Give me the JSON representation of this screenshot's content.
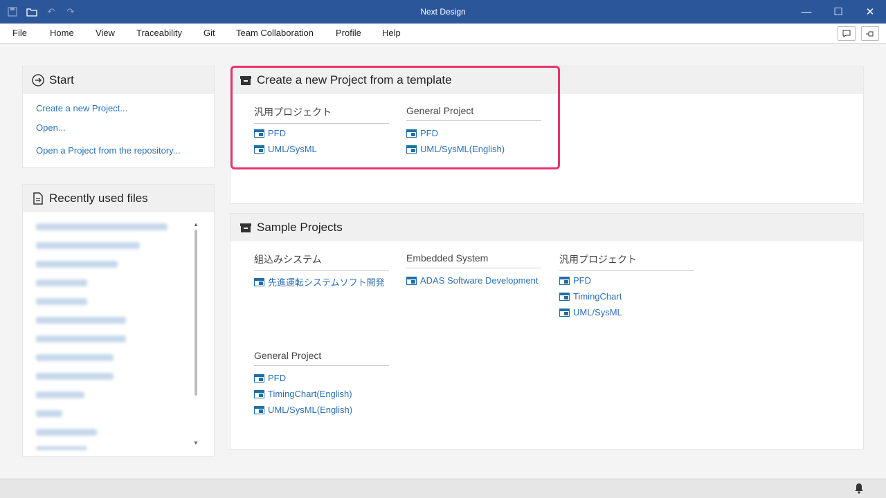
{
  "window": {
    "title": "Next Design"
  },
  "menu": [
    "File",
    "Home",
    "View",
    "Traceability",
    "Git",
    "Team Collaboration",
    "Profile",
    "Help"
  ],
  "start": {
    "title": "Start",
    "links": [
      "Create a new Project...",
      "Open...",
      "Open a Project from the repository..."
    ]
  },
  "recent": {
    "title": "Recently used files"
  },
  "templates": {
    "title": "Create a new Project from a template",
    "groups": [
      {
        "title": "汎用プロジェクト",
        "items": [
          "PFD",
          "UML/SysML"
        ]
      },
      {
        "title": "General Project",
        "items": [
          "PFD",
          "UML/SysML(English)"
        ]
      }
    ]
  },
  "samples": {
    "title": "Sample Projects",
    "groups": [
      {
        "title": "組込みシステム",
        "items": [
          "先進運転システムソフト開発"
        ]
      },
      {
        "title": "Embedded System",
        "items": [
          "ADAS Software Development"
        ]
      },
      {
        "title": "汎用プロジェクト",
        "items": [
          "PFD",
          "TimingChart",
          "UML/SysML"
        ]
      },
      {
        "title": "General Project",
        "items": [
          "PFD",
          "TimingChart(English)",
          "UML/SysML(English)"
        ]
      }
    ]
  },
  "colors": {
    "titlebar": "#2b579a",
    "link": "#2a6fb7",
    "highlight": "#e8336a"
  }
}
